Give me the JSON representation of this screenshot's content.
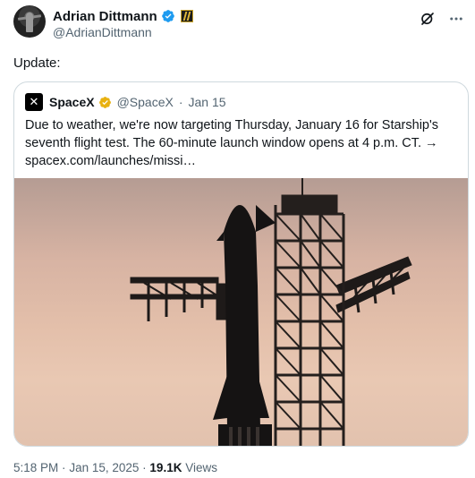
{
  "author": {
    "display_name": "Adrian Dittmann",
    "handle": "@AdrianDittmann",
    "verified_color": "#1d9bf0"
  },
  "tweet": {
    "text": "Update:"
  },
  "quoted": {
    "name": "SpaceX",
    "handle": "@SpaceX",
    "separator": "·",
    "date": "Jan 15",
    "logo_glyph": "✕",
    "badge_color": "#e8b10f",
    "text": "Due to weather, we're now targeting Thursday, January 16 for Starship's seventh flight test. The 60-minute launch window opens at 4 p.m. CT. → spacex.com/launches/missi…"
  },
  "footer": {
    "time": "5:18 PM",
    "separator": "·",
    "date": "Jan 15, 2025",
    "views_count": "19.1K",
    "views_label": "Views"
  },
  "icons": [
    "grok-icon",
    "more-options-icon",
    "verified-badge-icon",
    "flag-badge-icon",
    "x-logo-icon",
    "gold-check-badge-icon"
  ]
}
